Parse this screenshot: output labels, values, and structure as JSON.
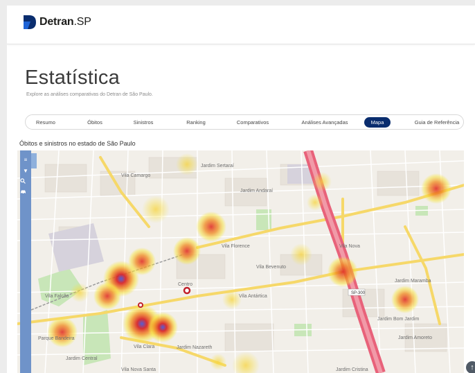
{
  "header": {
    "brand_main": "Detran",
    "brand_suffix": ".SP",
    "brand_color": "#0a2d6e"
  },
  "hero": {
    "title": "Estatística",
    "subtitle": "Explore as análises comparativas do Detran de São Paulo."
  },
  "tabs": [
    {
      "label": "Resumo",
      "active": false
    },
    {
      "label": "Óbitos",
      "active": false
    },
    {
      "label": "Sinistros",
      "active": false
    },
    {
      "label": "Ranking",
      "active": false
    },
    {
      "label": "Comparativos",
      "active": false
    },
    {
      "label": "Análises Avançadas",
      "active": false
    },
    {
      "label": "Mapa",
      "active": true
    },
    {
      "label": "Guia de Referência",
      "active": false
    }
  ],
  "map": {
    "section_title": "Óbitos e sinistros no estado de São Paulo",
    "toolbar_icons": [
      "layers-icon",
      "filter-icon",
      "search-icon",
      "car-icon"
    ],
    "place_labels": [
      "Vila Camargo",
      "Jardim Sertaraí",
      "Jardim Andaraí",
      "Vila Florence",
      "Vila Bevenuto",
      "Centro",
      "Vila Nova",
      "Vila Falcão",
      "Parque Bandeira",
      "Vila Clara",
      "Jardim Nazareth",
      "Vila Antártica",
      "Jardim Maramba",
      "Jardim Bom Jardim",
      "Jardim Central",
      "Jardim Amoreto",
      "Vila Nova Santa",
      "Jardim Cristina"
    ],
    "road_label": "SP-300",
    "colors": {
      "heat_hot": "#d8262a",
      "heat_warm": "#f08a1e",
      "heat_cool": "#f7e43c",
      "heat_core": "#5a5fd0",
      "highway": "#e8627a",
      "major_road": "#f6d869"
    }
  },
  "footer": {
    "scroll_top_icon": "arrow-up-icon"
  }
}
